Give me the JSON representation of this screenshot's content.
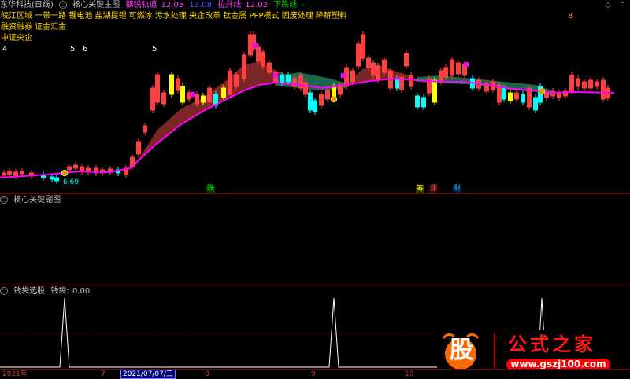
{
  "header": {
    "stock": "东华科技(日线)",
    "indicator": "核心关键主图",
    "line1_label": "镰锐轨道",
    "line1_value": "12.05",
    "line2_label": "13.08",
    "line3_label": "拉升线",
    "line3_value": "12.02",
    "line4_label": "下跌线",
    "line4_value": "-",
    "menu_icon": "diamond-icon",
    "close_icon": "chevron-up-icon"
  },
  "concepts": {
    "line1": "皖江区域 一带一路 锂电池 盐湖提锂 可燃冰 污水处理 央企改革 钛金属 PPP模式 固废处理 降解塑料",
    "line2": "融资融券 证金汇金",
    "line3": "中证央企"
  },
  "events": [
    "4",
    "5",
    "6",
    "5",
    "8"
  ],
  "chart_labels": {
    "low_price": "6.69",
    "bottom_tags": [
      "跌",
      "筹",
      "涨",
      "财"
    ]
  },
  "sub1": {
    "title": "核心关键副图"
  },
  "sub2": {
    "title": "钱袋选股",
    "label": "钱袋:",
    "value": "0.00"
  },
  "xaxis": {
    "year": "2021年",
    "m7": "7",
    "date": "2021/07/07/三",
    "m8": "8",
    "m9": "9",
    "m10": "10"
  },
  "watermark": {
    "logo": "股",
    "title": "公式之家",
    "url": "www.gszj100.com"
  },
  "colors": {
    "up": "#ff4040",
    "down": "#00ffff",
    "magenta": "#ff00ff",
    "yellow": "#ffff00",
    "green_band": "#1f6b4d",
    "red_band": "#8a2a2a"
  }
}
